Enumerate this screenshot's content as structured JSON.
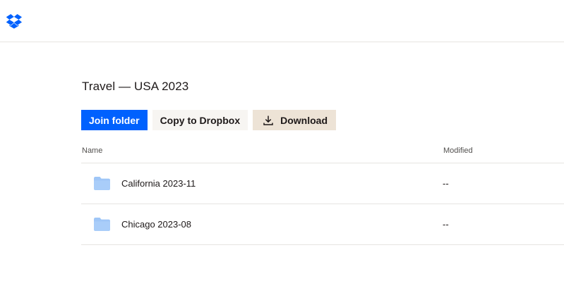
{
  "header": {
    "logo_icon": "dropbox-logo-icon",
    "brand_color": "#0061fe"
  },
  "folder": {
    "title": "Travel — USA 2023"
  },
  "actions": {
    "join_label": "Join folder",
    "copy_label": "Copy to Dropbox",
    "download_label": "Download",
    "download_icon": "download-icon"
  },
  "table": {
    "columns": {
      "name": "Name",
      "modified": "Modified"
    },
    "rows": [
      {
        "icon": "folder-icon",
        "name": "California 2023-11",
        "modified": "--"
      },
      {
        "icon": "folder-icon",
        "name": "Chicago 2023-08",
        "modified": "--"
      }
    ]
  }
}
